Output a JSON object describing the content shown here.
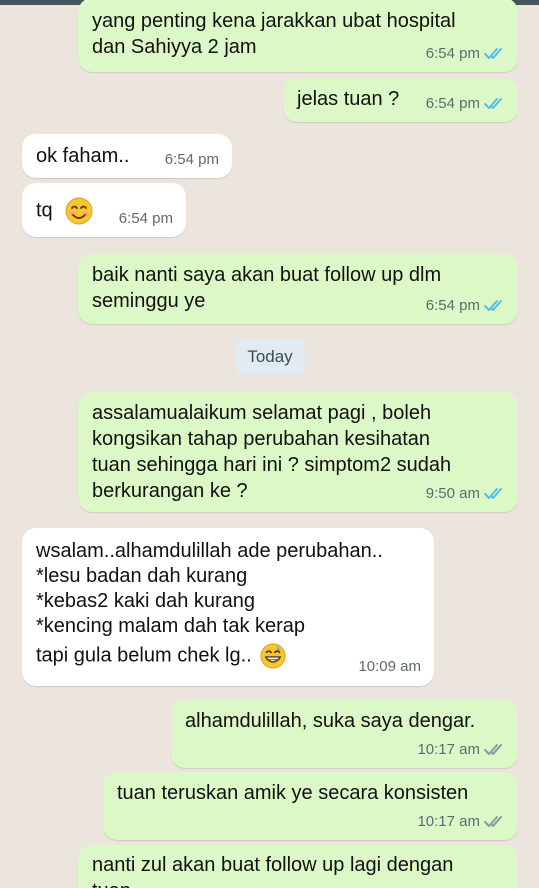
{
  "theme": {
    "out_bubble": "#dcf8c6",
    "in_bubble": "#ffffff",
    "tick_read": "#53bdeb",
    "tick_sent": "#8a9aa3",
    "wallpaper": "#ece5dd"
  },
  "messages": [
    {
      "lines": [
        "yang penting kena jarakkan ubat hospital",
        "dan Sahiyya 2 jam"
      ],
      "time": "6:54 pm",
      "dir": "out",
      "status": "read"
    },
    {
      "lines": [
        "jelas tuan ?"
      ],
      "time": "6:54 pm",
      "dir": "out",
      "status": "read"
    },
    {
      "lines": [
        "ok faham.."
      ],
      "time": "6:54 pm",
      "dir": "in"
    },
    {
      "lines": [
        "tq"
      ],
      "emoji": "smiling-face-emoji",
      "time": "6:54 pm",
      "dir": "in"
    },
    {
      "lines": [
        "baik nanti saya akan buat follow up dlm",
        "seminggu ye"
      ],
      "time": "6:54 pm",
      "dir": "out",
      "status": "read"
    },
    {
      "lines": [
        "assalamualaikum selamat pagi , boleh",
        "kongsikan tahap perubahan kesihatan",
        "tuan sehingga hari ini ? simptom2 sudah",
        "berkurangan ke ?"
      ],
      "time": "9:50 am",
      "dir": "out",
      "status": "read"
    },
    {
      "lines": [
        "wsalam..alhamdulillah ade perubahan..",
        "*lesu badan dah kurang",
        "*kebas2 kaki dah kurang",
        "*kencing malam dah tak kerap",
        "tapi gula belum chek lg.."
      ],
      "emoji": "grinning-sweat-emoji",
      "time": "10:09 am",
      "dir": "in"
    },
    {
      "lines": [
        "alhamdulillah, suka saya dengar."
      ],
      "time": "10:17 am",
      "dir": "out",
      "status": "sent"
    },
    {
      "lines": [
        "tuan teruskan amik ye secara konsisten"
      ],
      "time": "10:17 am",
      "dir": "out",
      "status": "sent"
    },
    {
      "lines": [
        "nanti zul akan buat follow up lagi dengan",
        "tuan"
      ],
      "dir": "out"
    }
  ],
  "day_separator": "Today"
}
